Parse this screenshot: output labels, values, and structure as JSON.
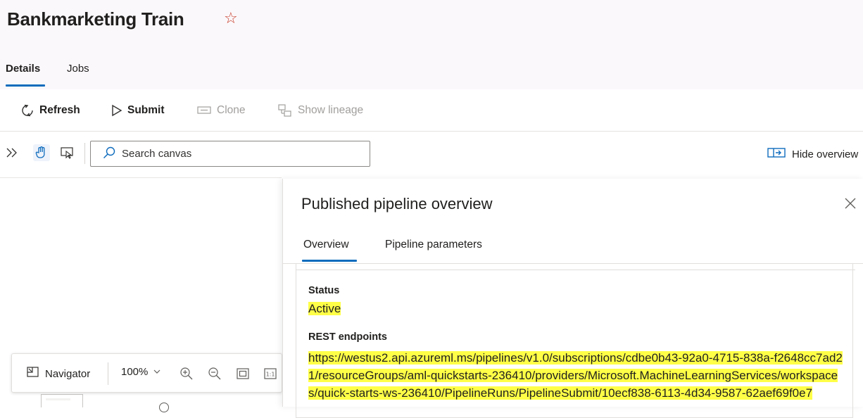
{
  "page": {
    "title": "Bankmarketing Train",
    "favorite_icon": "star-icon"
  },
  "tabs": [
    {
      "label": "Details",
      "active": true
    },
    {
      "label": "Jobs",
      "active": false
    }
  ],
  "toolbar": {
    "refresh_label": "Refresh",
    "submit_label": "Submit",
    "clone_label": "Clone",
    "show_lineage_label": "Show lineage"
  },
  "canvas_toolbar": {
    "search_placeholder": "Search canvas",
    "hide_overview_label": "Hide overview"
  },
  "navigator": {
    "label": "Navigator",
    "zoom_level": "100%"
  },
  "panel": {
    "title": "Published pipeline overview",
    "tabs": [
      {
        "label": "Overview",
        "active": true
      },
      {
        "label": "Pipeline parameters",
        "active": false
      }
    ],
    "status_label": "Status",
    "status_value": "Active",
    "rest_label": "REST endpoints",
    "rest_endpoint": "https://westus2.api.azureml.ms/pipelines/v1.0/subscriptions/cdbe0b43-92a0-4715-838a-f2648cc7ad21/resourceGroups/aml-quickstarts-236410/providers/Microsoft.MachineLearningServices/workspaces/quick-starts-ws-236410/PipelineRuns/PipelineSubmit/10ecf838-6113-4d34-9587-62aef69f0e7"
  },
  "colors": {
    "accent": "#0f6cbd",
    "highlight": "#ffff47",
    "star": "#c73c28",
    "header_bg": "#fbf8fb"
  }
}
